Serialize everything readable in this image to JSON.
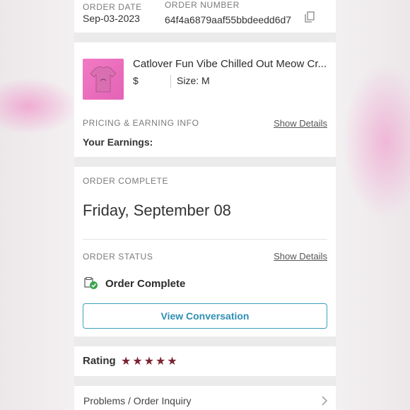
{
  "order": {
    "date_label": "ORDER DATE",
    "date_value": "Sep-03-2023",
    "number_label": "ORDER NUMBER",
    "number_value": "64f4a6879aaf55bbdeedd6d7"
  },
  "item": {
    "title": "Catlover Fun Vibe Chilled Out Meow Cr...",
    "price": "$",
    "size": "Size: M"
  },
  "pricing": {
    "label": "PRICING & EARNING INFO",
    "show_details": "Show Details",
    "earnings_label": "Your Earnings:"
  },
  "complete": {
    "label": "ORDER COMPLETE",
    "date": "Friday, September 08"
  },
  "status": {
    "label": "ORDER STATUS",
    "show_details": "Show Details",
    "value": "Order Complete",
    "status_color": "#3aa54b"
  },
  "actions": {
    "view_conversation": "View Conversation"
  },
  "rating": {
    "label": "Rating",
    "stars": 5,
    "star_color": "#7b2331"
  },
  "help": {
    "problems": "Problems / Order Inquiry"
  }
}
